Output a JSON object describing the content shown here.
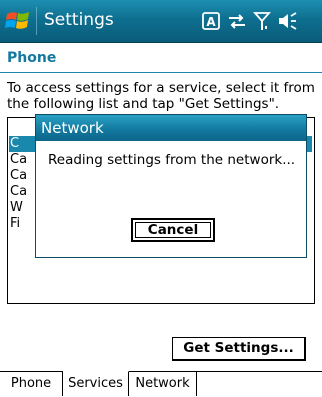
{
  "titlebar": {
    "title": "Settings",
    "icons": [
      "windows-start-icon",
      "input-method-icon",
      "connectivity-icon",
      "signal-icon",
      "volume-icon"
    ]
  },
  "header": {
    "title": "Phone"
  },
  "instructions": "To access settings for a service, select it from the following list and tap \"Get Settings\".",
  "service_list": {
    "items": [
      "C",
      "Ca",
      "Ca",
      "Ca",
      "W",
      "Fi"
    ],
    "selected_index": 0
  },
  "dialog": {
    "title": "Network",
    "message": "Reading settings from the network...",
    "cancel_label": "Cancel"
  },
  "get_settings_label": "Get Settings...",
  "tabs": [
    {
      "label": "Phone",
      "active": false
    },
    {
      "label": "Services",
      "active": true
    },
    {
      "label": "Network",
      "active": false
    }
  ],
  "colors": {
    "accent": "#1a87ad",
    "header_text": "#15799f"
  }
}
